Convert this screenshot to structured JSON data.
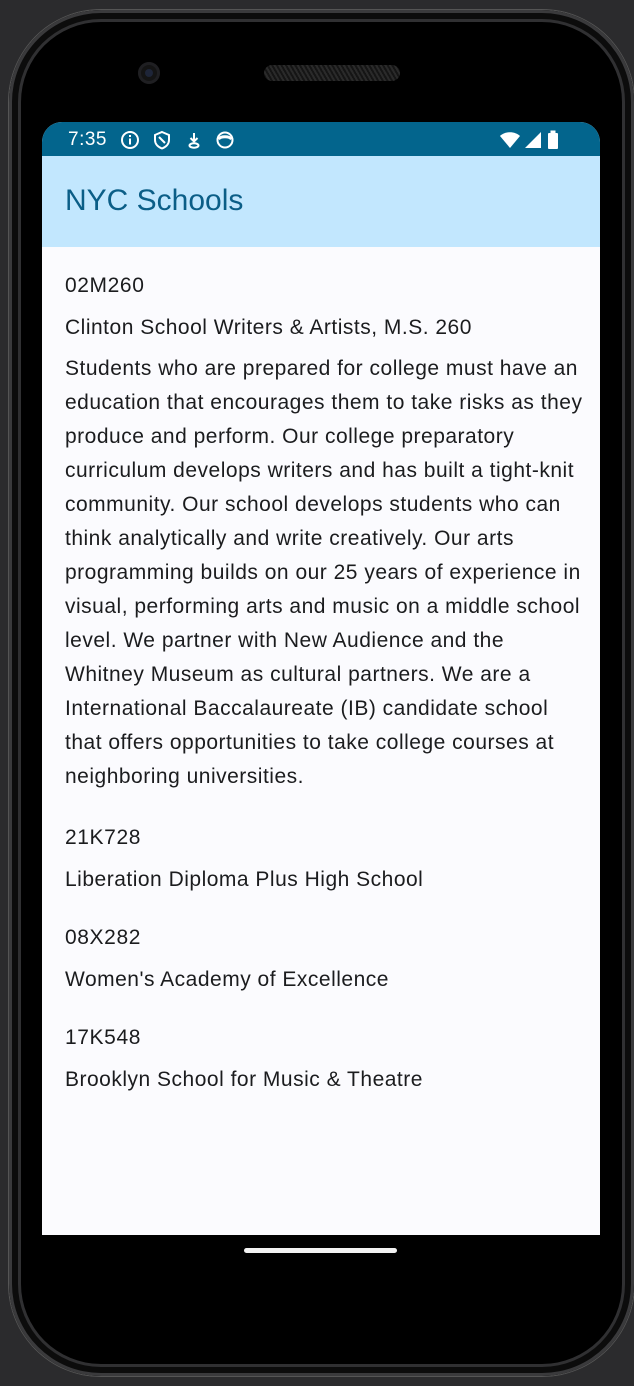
{
  "status_bar": {
    "time": "7:35",
    "left_icons": [
      "info-icon",
      "shield-icon",
      "download-icon",
      "face-icon"
    ],
    "right_icons": [
      "wifi-icon",
      "signal-icon",
      "battery-icon"
    ]
  },
  "app_bar": {
    "title": "NYC Schools"
  },
  "colors": {
    "status_bar": "#03658d",
    "app_bar": "#c2e7fe",
    "title": "#0b5e87",
    "background": "#fbfbfe"
  },
  "schools": [
    {
      "dbn": "02M260",
      "name": "Clinton School Writers & Artists, M.S. 260",
      "overview": "Students who are prepared for college must have an education that encourages them to take risks as they produce and perform. Our college preparatory curriculum develops writers and has built a tight-knit community. Our school develops students who can think analytically and write creatively. Our arts programming builds on our 25 years of experience in visual, performing arts and music on a middle school level. We partner with New Audience and the Whitney Museum as cultural partners. We are a International Baccalaureate (IB) candidate school that offers opportunities to take college courses at neighboring universities."
    },
    {
      "dbn": "21K728",
      "name": "Liberation Diploma Plus High School"
    },
    {
      "dbn": "08X282",
      "name": "Women's Academy of Excellence"
    },
    {
      "dbn": "17K548",
      "name": "Brooklyn School for Music & Theatre"
    }
  ]
}
